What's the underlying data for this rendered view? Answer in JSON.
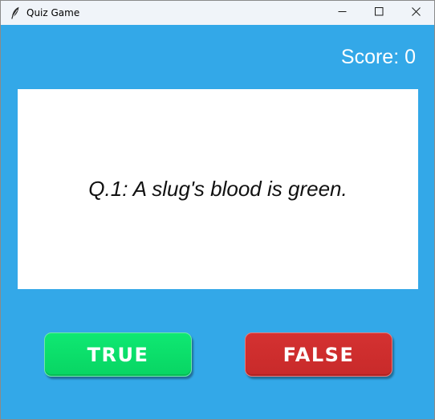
{
  "window": {
    "title": "Quiz Game",
    "app_icon": "feather-icon",
    "controls": {
      "minimize_icon": "minimize-icon",
      "maximize_icon": "maximize-icon",
      "close_icon": "close-icon"
    }
  },
  "score": {
    "text": "Score: 0"
  },
  "question": {
    "text": "Q.1: A slug's blood is green."
  },
  "buttons": {
    "true_label": "TRUE",
    "false_label": "FALSE"
  },
  "colors": {
    "background": "#33a8e8",
    "true_button": "#08de69",
    "false_button": "#cc2e2e",
    "card": "#ffffff"
  }
}
